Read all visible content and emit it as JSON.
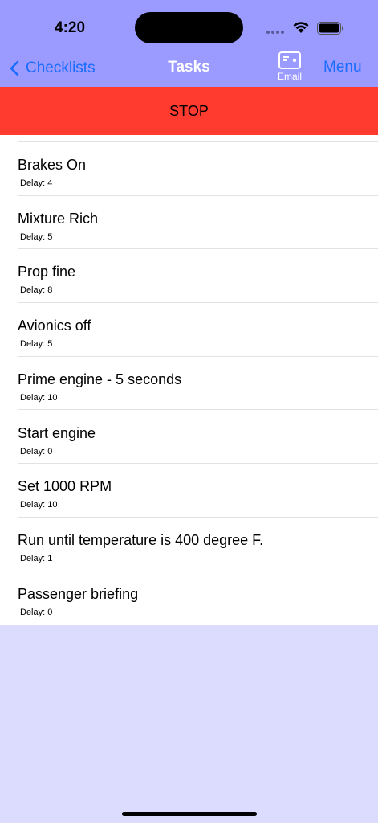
{
  "status": {
    "time": "4:20"
  },
  "nav": {
    "back_label": "Checklists",
    "title": "Tasks",
    "email_label": "Email",
    "menu_label": "Menu"
  },
  "stop_label": "STOP",
  "tasks": [
    {
      "title": "Brakes On",
      "delay": "Delay: 4"
    },
    {
      "title": "Mixture Rich",
      "delay": "Delay: 5"
    },
    {
      "title": "Prop fine",
      "delay": "Delay: 8"
    },
    {
      "title": "Avionics off",
      "delay": "Delay: 5"
    },
    {
      "title": "Prime engine - 5 seconds",
      "delay": "Delay: 10"
    },
    {
      "title": "Start engine",
      "delay": "Delay: 0"
    },
    {
      "title": "Set 1000 RPM",
      "delay": "Delay: 10"
    },
    {
      "title": "Run until temperature is 400 degree F.",
      "delay": "Delay: 1"
    },
    {
      "title": "Passenger briefing",
      "delay": "Delay: 0"
    }
  ],
  "colors": {
    "nav_bar": "#9a9aff",
    "background": "#dcdcff",
    "accent": "#1a6cff",
    "stop": "#ff3b30"
  }
}
